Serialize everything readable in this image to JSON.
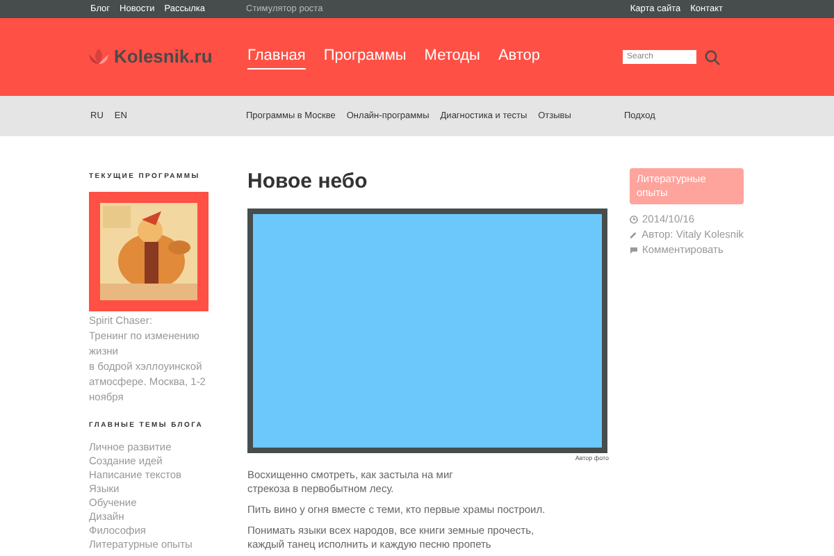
{
  "top_bar": {
    "left_links": [
      "Блог",
      "Новости",
      "Рассылка"
    ],
    "tagline": "Стимулятор роста",
    "right_links": [
      "Карта сайта",
      "Контакт"
    ]
  },
  "header": {
    "logo": "Kolesnik.ru",
    "nav": [
      {
        "label": "Главная",
        "selected": true
      },
      {
        "label": "Программы",
        "selected": false
      },
      {
        "label": "Методы",
        "selected": false
      },
      {
        "label": "Автор",
        "selected": false
      }
    ],
    "search": {
      "placeholder": "Search"
    }
  },
  "sub_nav": {
    "languages": [
      "RU",
      "EN"
    ],
    "links": [
      "Программы в Москве",
      "Онлайн-программы",
      "Диагностика и тесты",
      "Отзывы"
    ],
    "right_link": "Подход"
  },
  "sidebar": {
    "programs_heading": "ТЕКУЩИЕ ПРОГРАММЫ",
    "program_lines": [
      "Spirit Chaser:",
      "Тренинг по изменению жизни",
      "в бодрой хэллоуинской атмосфере. Москва, 1-2 ноября"
    ],
    "topics_heading": "ГЛАВНЫЕ ТЕМЫ БЛОГА",
    "topics": [
      "Личное развитие",
      "Создание идей",
      "Написание текстов",
      "Языки",
      "Обучение",
      "Дизайн",
      "Философия",
      "Литературные опыты"
    ]
  },
  "article": {
    "title": "Новое небо",
    "image_caption": "Автор фото",
    "paragraphs": [
      "Восхищенно смотреть, как застыла на миг\nстрекоза в первобытном лесу.",
      "Пить вино у огня вместе с теми, кто первые храмы построил.",
      "Понимать языки всех народов, все книги земные прочесть,\nкаждый танец исполнить и каждую песню пропеть"
    ]
  },
  "meta": {
    "category": "Литературные опыты",
    "date": "2014/10/16",
    "author": "Автор: Vitaly Kolesnik",
    "comments": "Комментировать"
  }
}
